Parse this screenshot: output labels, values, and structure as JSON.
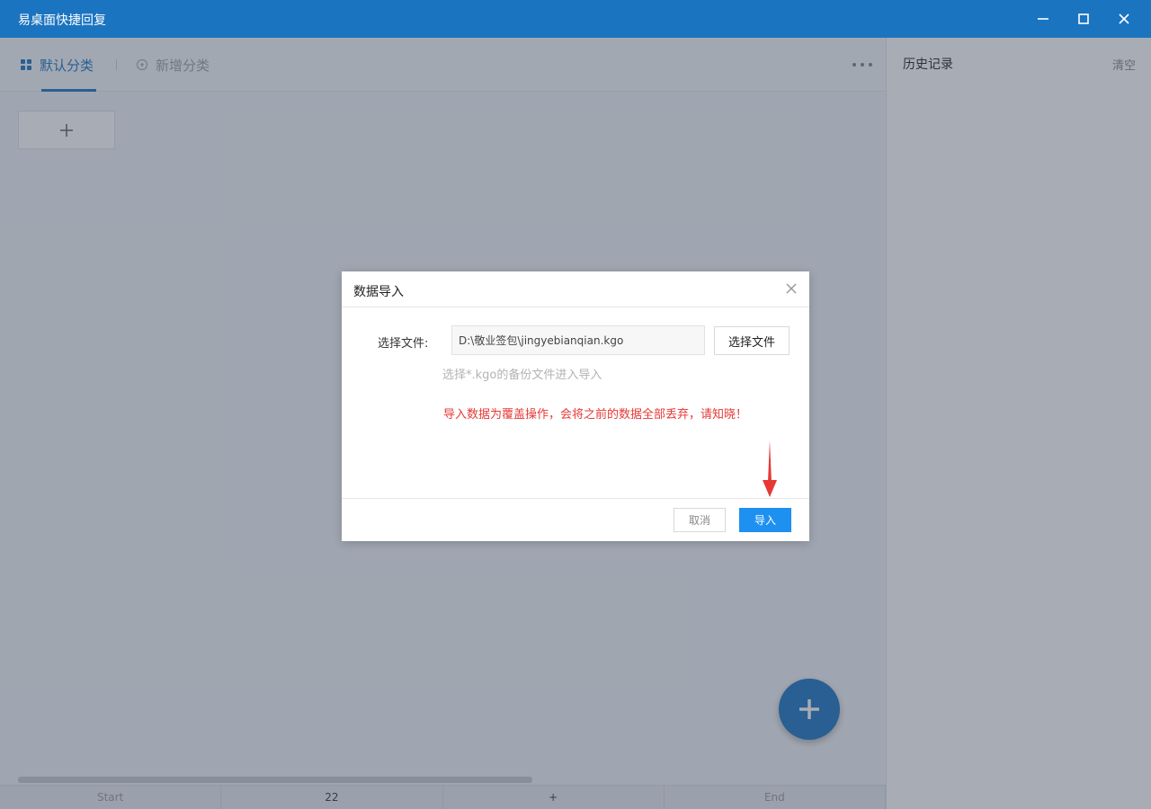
{
  "window": {
    "title": "易桌面快捷回复",
    "controls": [
      "minimize-icon",
      "maximize-icon",
      "close-icon"
    ]
  },
  "tabs": {
    "active_label": "默认分类",
    "add_label": "新增分类"
  },
  "history": {
    "title": "历史记录",
    "clear_label": "清空"
  },
  "footer": {
    "cells": [
      "Start",
      "22",
      "+",
      "End"
    ]
  },
  "dialog": {
    "title": "数据导入",
    "file_label": "选择文件:",
    "file_path": "D:\\敬业签包\\jingyebianqian.kgo",
    "choose_button": "选择文件",
    "hint": "选择*.kgo的备份文件进入导入",
    "warning": "导入数据为覆盖操作，会将之前的数据全部丢弃，请知晓！",
    "cancel_button": "取消",
    "import_button": "导入"
  },
  "colors": {
    "primary": "#1b74c0",
    "import_button": "#1e90f0",
    "warning": "#e53935",
    "arrow": "#e53935"
  }
}
